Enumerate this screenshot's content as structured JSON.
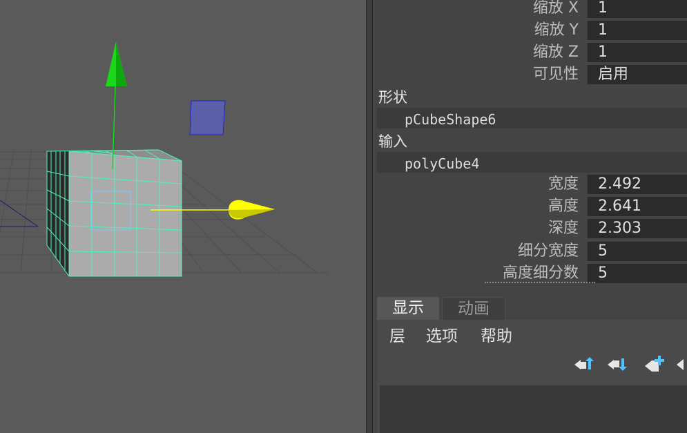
{
  "transform": {
    "rows": [
      {
        "label": "缩放 X",
        "value": "1"
      },
      {
        "label": "缩放 Y",
        "value": "1"
      },
      {
        "label": "缩放 Z",
        "value": "1"
      },
      {
        "label": "可见性",
        "value": "启用"
      }
    ]
  },
  "shape": {
    "header": "形状",
    "node": "pCubeShape6"
  },
  "inputs": {
    "header": "输入",
    "node": "polyCube4",
    "rows": [
      {
        "label": "宽度",
        "value": "2.492"
      },
      {
        "label": "高度",
        "value": "2.641"
      },
      {
        "label": "深度",
        "value": "2.303"
      },
      {
        "label": "细分宽度",
        "value": "5"
      },
      {
        "label": "高度细分数",
        "value": "5"
      }
    ]
  },
  "layer_editor": {
    "tabs": [
      "显示",
      "动画"
    ],
    "active_tab": "显示",
    "menu": [
      "层",
      "选项",
      "帮助"
    ],
    "icons": [
      "move-layer-up-icon",
      "move-layer-down-icon",
      "create-empty-layer-icon",
      "create-layer-from-selected-icon"
    ]
  },
  "colors": {
    "viewport_bg": "#5a5a5a",
    "wireframe": "#4ff5b4",
    "axis_y": "#1ad81a",
    "axis_x": "#ffff00",
    "panel_bg": "#444444"
  }
}
